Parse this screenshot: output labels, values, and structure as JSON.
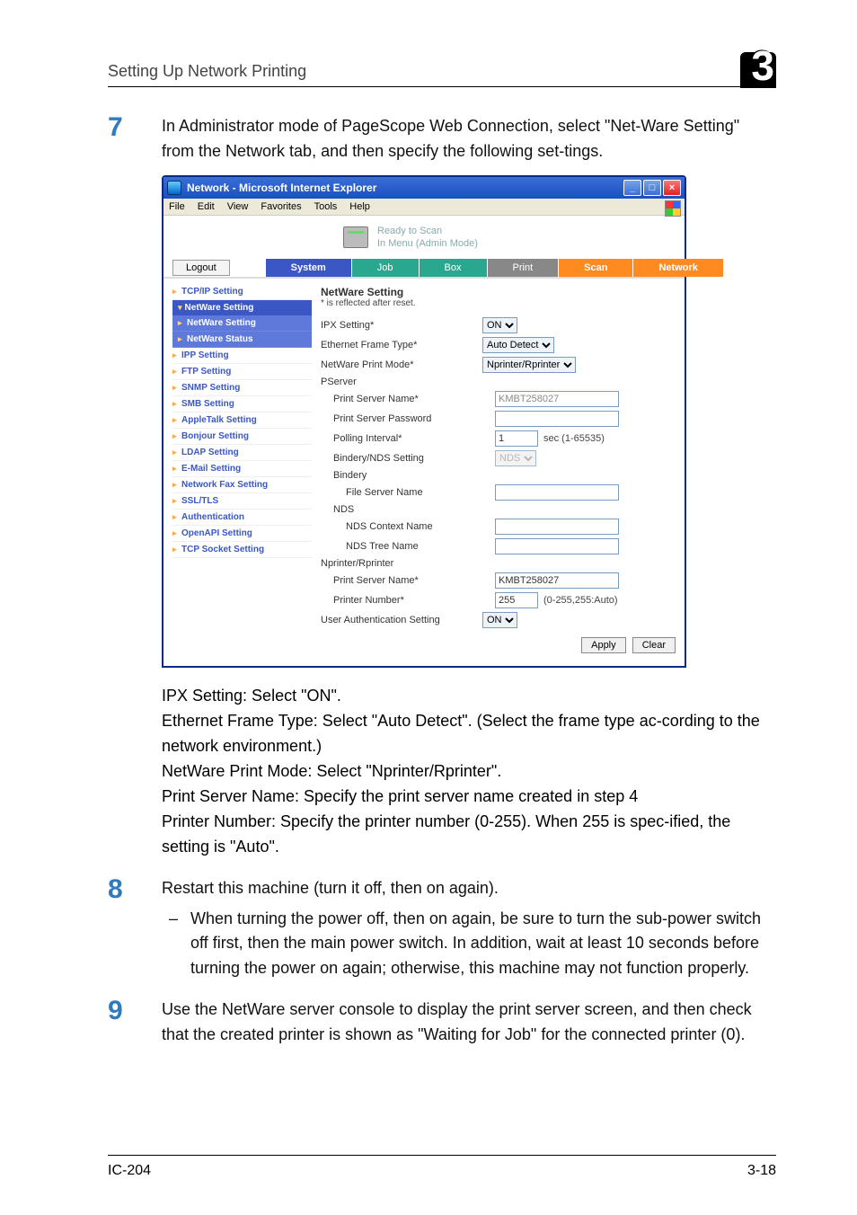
{
  "header": {
    "section_title": "Setting Up Network Printing",
    "chapter_number": "3"
  },
  "steps": {
    "step7": {
      "num": "7",
      "text": "In Administrator mode of PageScope Web Connection, select \"Net-Ware Setting\" from the Network tab, and then specify the following set-tings."
    },
    "step8": {
      "num": "8",
      "text": "Restart this machine (turn it off, then on again).",
      "bullet": "When turning the power off, then on again, be sure to turn the sub-power switch off first, then the main power switch. In addition, wait at least 10 seconds before turning the power on again; otherwise, this machine may not function properly."
    },
    "step9": {
      "num": "9",
      "text": "Use the NetWare server console to display the print server screen, and then check that the created printer is shown as \"Waiting for Job\" for the connected printer (0)."
    }
  },
  "screenshot": {
    "window_title": "Network - Microsoft Internet Explorer",
    "menubar": [
      "File",
      "Edit",
      "View",
      "Favorites",
      "Tools",
      "Help"
    ],
    "status": {
      "line1": "Ready to Scan",
      "line2": "In Menu (Admin Mode)"
    },
    "logout": "Logout",
    "tabs": [
      "System",
      "Job",
      "Box",
      "Print",
      "Scan",
      "Network"
    ],
    "sidebar": {
      "tcpip": "TCP/IP Setting",
      "netware_hdr": "NetWare Setting",
      "netware_setting": "NetWare Setting",
      "netware_status": "NetWare Status",
      "ipp": "IPP Setting",
      "ftp": "FTP Setting",
      "snmp": "SNMP Setting",
      "smb": "SMB Setting",
      "appletalk": "AppleTalk Setting",
      "bonjour": "Bonjour Setting",
      "ldap": "LDAP Setting",
      "email": "E-Mail Setting",
      "netfax": "Network Fax Setting",
      "ssl": "SSL/TLS",
      "auth": "Authentication",
      "openapi": "OpenAPI Setting",
      "tcpsocket": "TCP Socket Setting"
    },
    "panel": {
      "title": "NetWare Setting",
      "note": "* is reflected after reset.",
      "ipx_label": "IPX Setting*",
      "ipx_value": "ON",
      "frame_label": "Ethernet Frame Type*",
      "frame_value": "Auto Detect",
      "mode_label": "NetWare Print Mode*",
      "mode_value": "Nprinter/Rprinter",
      "pserver_group": "PServer",
      "psname_label": "Print Server Name*",
      "psname_value": "KMBT258027",
      "pspass_label": "Print Server Password",
      "poll_label": "Polling Interval*",
      "poll_value": "1",
      "poll_suffix": "sec (1-65535)",
      "bindnds_label": "Bindery/NDS Setting",
      "bindnds_value": "NDS",
      "bindery_group": "Bindery",
      "fsname_label": "File Server Name",
      "nds_group": "NDS",
      "ndsctx_label": "NDS Context Name",
      "ndstree_label": "NDS Tree Name",
      "nprinter_group": "Nprinter/Rprinter",
      "np_psname_label": "Print Server Name*",
      "np_psname_value": "KMBT258027",
      "np_num_label": "Printer Number*",
      "np_num_value": "255",
      "np_num_suffix": "(0-255,255:Auto)",
      "userauth_label": "User Authentication Setting",
      "userauth_value": "ON",
      "apply": "Apply",
      "clear": "Clear"
    }
  },
  "description": {
    "l1": "IPX Setting: Select \"ON\".",
    "l2": "Ethernet Frame Type: Select \"Auto Detect\". (Select the frame type ac-cording to the network environment.)",
    "l3": "NetWare Print Mode: Select \"Nprinter/Rprinter\".",
    "l4": "Print Server Name: Specify the print server name created in step 4",
    "l5": "Printer Number: Specify the printer number (0-255). When 255 is spec-ified, the setting is \"Auto\"."
  },
  "footer": {
    "left": "IC-204",
    "right": "3-18"
  }
}
